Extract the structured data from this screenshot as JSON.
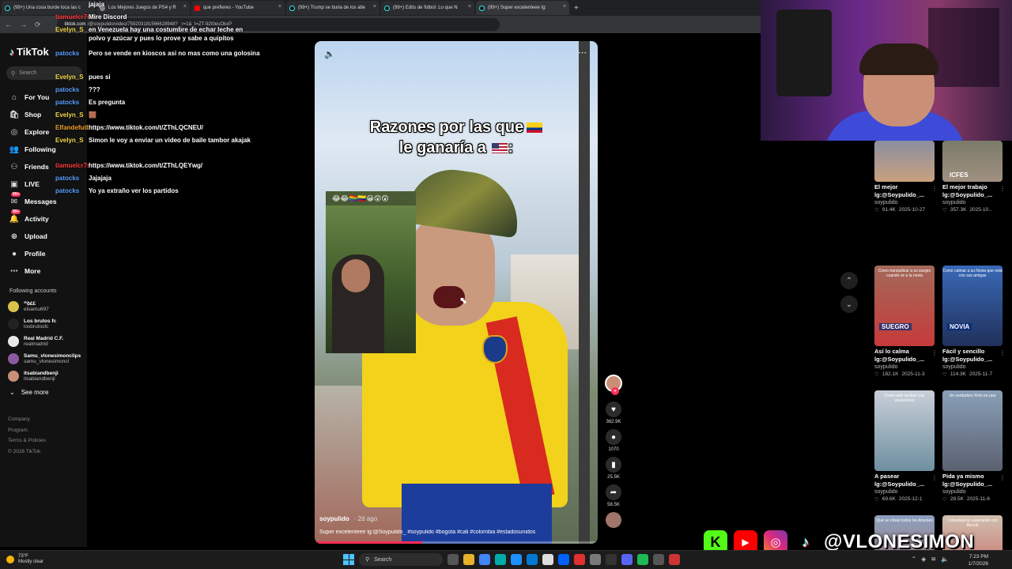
{
  "browser": {
    "tabs": [
      {
        "label": "(99+) Una cosa burde loca las c",
        "icon": "tiktok-icon"
      },
      {
        "label": "Los Mejores Juegos de PS4 y R",
        "icon": "page-icon"
      },
      {
        "label": "que prefieres - YouTube",
        "icon": "youtube-icon"
      },
      {
        "label": "(99+) Trump se burla de los atle",
        "icon": "tiktok-icon"
      },
      {
        "label": "(99+) Edits de fútbol: Lo que N",
        "icon": "tiktok-icon"
      },
      {
        "label": "(99+) Super excelenteee lg:",
        "icon": "tiktok-icon"
      }
    ],
    "url_host": "tiktok.com",
    "url_path": "/@soypulido/video/759203181566628948? _r=1&_t=ZT-92t0euOkxP"
  },
  "sidebar": {
    "logo": "TikTok",
    "search_placeholder": "Search",
    "nav": [
      {
        "label": "For You",
        "icon": "home-icon"
      },
      {
        "label": "Shop",
        "icon": "shop-icon"
      },
      {
        "label": "Explore",
        "icon": "compass-icon"
      },
      {
        "label": "Following",
        "icon": "following-icon"
      },
      {
        "label": "Friends",
        "icon": "friends-icon"
      },
      {
        "label": "LIVE",
        "icon": "live-icon"
      },
      {
        "label": "Messages",
        "icon": "messages-icon",
        "badge": "99+"
      },
      {
        "label": "Activity",
        "icon": "activity-icon",
        "badge": "99+"
      },
      {
        "label": "Upload",
        "icon": "upload-icon"
      },
      {
        "label": "Profile",
        "icon": "profile-icon"
      },
      {
        "label": "More",
        "icon": "more-icon"
      }
    ],
    "following_title": "Following accounts",
    "following": [
      {
        "name": "ꟸꝺ££",
        "user": "elsamu697",
        "color": "#d8c24a"
      },
      {
        "name": "Los brutos fc",
        "user": "losbrutosfc",
        "color": "#222"
      },
      {
        "name": "Real Madrid C.F.",
        "user": "realmadrid",
        "color": "#e8e8e8"
      },
      {
        "name": "Samu_vlonesimonclips",
        "user": "samu_vlonesimoncl",
        "color": "#8a5aa0"
      },
      {
        "name": "itsabiandbenji",
        "user": "itsabiandbenji",
        "color": "#c99077"
      }
    ],
    "see_more": "See more",
    "footer": [
      "Company",
      "Program",
      "Terms & Policies",
      "© 2026 TikTok"
    ]
  },
  "chat": [
    {
      "user": "",
      "text": "jajaja",
      "color": "#ff6b6b"
    },
    {
      "user": "tiamuelcr7siuuu",
      "text": "Mire Discord",
      "color": "#ff3b3b"
    },
    {
      "user": "Evelyn_S",
      "text": "en Venezuela hay una costumbre de echar leche en polvo y azúcar y pues lo prove y sabe a quipitos",
      "color": "#f5d94a"
    },
    {
      "user": "patocks",
      "text": "Pero se vende en kioscos asi no mas como una golosina",
      "color": "#5aa0ff"
    },
    {
      "user": "Evelyn_S",
      "text": "pues si",
      "color": "#f5d94a"
    },
    {
      "user": "patocks",
      "text": "???",
      "color": "#5aa0ff"
    },
    {
      "user": "patocks",
      "text": "Es pregunta",
      "color": "#5aa0ff"
    },
    {
      "user": "Evelyn_S",
      "text": "🟫",
      "color": "#f5d94a"
    },
    {
      "user": "Elfandefutbol",
      "text": "https://www.tiktok.com/t/ZThLQCNEU/",
      "color": "#f0a030"
    },
    {
      "user": "Evelyn_S",
      "text": "Simon le voy a enviar un video de baile tambor akajak",
      "color": "#f5d94a"
    },
    {
      "user": "tiamuelcr7siuuu",
      "text": "https://www.tiktok.com/t/ZThLQEYwg/",
      "color": "#ff3b3b"
    },
    {
      "user": "patocks",
      "text": "Jajajaja",
      "color": "#5aa0ff"
    },
    {
      "user": "patocks",
      "text": "Yo ya extraño ver los partidos",
      "color": "#5aa0ff"
    }
  ],
  "video": {
    "title_line1": "Razones por las que",
    "title_line2": "le ganaría a",
    "author": "soypulido",
    "date": "· 2d ago",
    "caption": "Super excelenteee lg:@Soypulido_ #soypulido #bogota #cali #colombia #estadosunidos",
    "pip_emojis": "😂😂🏳️‍🌈🇨🇴😀😲😲",
    "progress": 0.38
  },
  "actions": [
    {
      "name": "like",
      "icon": "heart-icon",
      "glyph": "♥",
      "count": "362.9K"
    },
    {
      "name": "comment",
      "icon": "comment-icon",
      "glyph": "●",
      "count": "1070"
    },
    {
      "name": "bookmark",
      "icon": "bookmark-icon",
      "glyph": "▮",
      "count": "25.5K"
    },
    {
      "name": "share",
      "icon": "share-icon",
      "glyph": "➦",
      "count": "58.5K"
    }
  ],
  "recommended": [
    {
      "title": "El mejor lg:@Soypulido_...",
      "user": "soypulido",
      "views": "91.4K",
      "date": "2025-10-27",
      "thumb_text": "",
      "label": "",
      "bg": "linear-gradient(180deg,#8a8fa0,#c9a07e)"
    },
    {
      "title": "El mejor trabajo lg:@Soypulido_...",
      "user": "soypulido",
      "views": "357.3K",
      "date": "2025-10...",
      "thumb_text": "",
      "label": "ICFES",
      "bg": "linear-gradient(180deg,#7b7b6a,#a09080)"
    },
    {
      "title": "Así lo calma lg:@Soypulido_...",
      "user": "soypulido",
      "views": "182.1K",
      "date": "2025-11-3",
      "thumb_text": "Como tranquilizar a su suegro cuando ve a la novia",
      "label": "SUEGRO",
      "bg": "linear-gradient(180deg,#a36a5a,#c63a3a)"
    },
    {
      "title": "Fácil y sencillo lg:@Soypulido_...",
      "user": "soypulido",
      "views": "114.3K",
      "date": "2025-11-7",
      "thumb_text": "Como calmar a su Novia que está con sus amigas",
      "label": "NOVIA",
      "bg": "linear-gradient(180deg,#3a6ab8,#20305a)"
    },
    {
      "title": "A pasear lg:@Soypulido_...",
      "user": "soypulido",
      "views": "69.6K",
      "date": "2025-12-1",
      "thumb_text": "Como salir reciben sus vacaciones",
      "label": "",
      "bg": "linear-gradient(180deg,#c9cfd8,#6f8fa0)"
    },
    {
      "title": "Pida ya mismo lg:@Soypulido_...",
      "user": "soypulido",
      "views": "28.5K",
      "date": "2025-11-6",
      "thumb_text": "Un verdadero Rolo en una",
      "label": "",
      "bg": "linear-gradient(180deg,#8aa0b8,#5a6070)"
    },
    {
      "title": "",
      "user": "",
      "views": "",
      "date": "",
      "thumb_text": "Qué se roban todos los Artumes",
      "label": "",
      "bg": "linear-gradient(180deg,#8aa0c0,#b86a5a)"
    },
    {
      "title": "",
      "user": "",
      "views": "",
      "date": "",
      "thumb_text": "Colombianos esperando con Bizcok",
      "label": "",
      "bg": "linear-gradient(180deg,#d0c0b0,#c85050)"
    }
  ],
  "social": {
    "handle": "@VLONESIMON"
  },
  "taskbar": {
    "temp": "73°F",
    "weather": "Mostly clear",
    "search": "Search",
    "time": "7:23 PM",
    "date": "1/7/2026"
  }
}
